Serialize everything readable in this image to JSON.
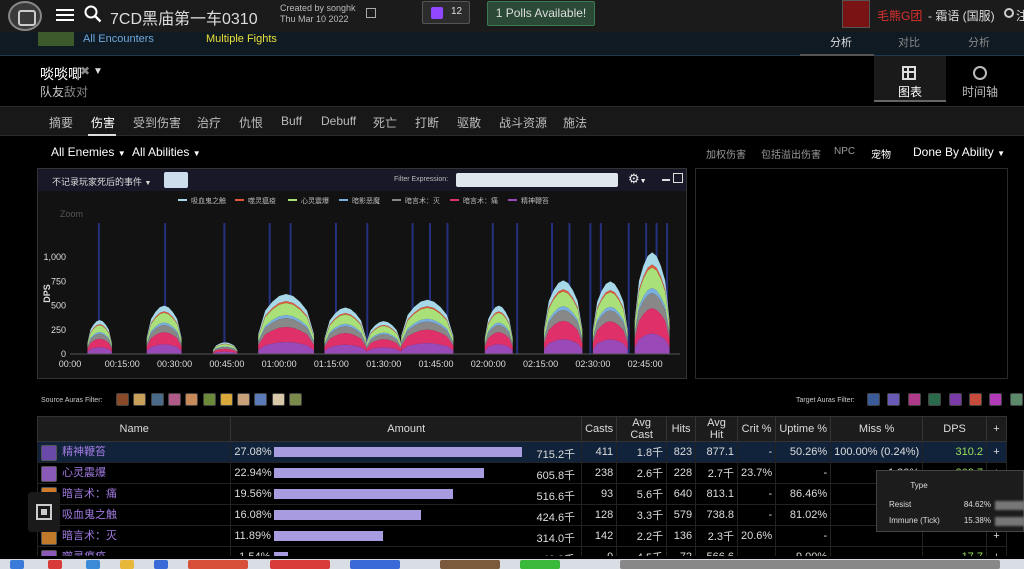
{
  "header": {
    "report_title": "7CD黑庙第一车0310",
    "created_by": "Created by songhk",
    "created_date": "Thu Mar 10 2022",
    "twitch_count": "12",
    "polls_label": "1 Polls Available!",
    "guild_name": "毛熊G团",
    "server_name": "- 霜语 (国服)",
    "user_name": "注"
  },
  "encounter_strip": {
    "all_encounters": "All Encounters",
    "multiple_fights": "Multiple Fights",
    "tabs": [
      "分析",
      "对比",
      "分析"
    ]
  },
  "player": {
    "name": "啖啖唧",
    "friend_label": "队友",
    "enemy_label": "敌对"
  },
  "view_buttons": {
    "chart": "图表",
    "timeline": "时间轴"
  },
  "tabs": [
    "摘要",
    "伤害",
    "受到伤害",
    "治疗",
    "仇恨",
    "Buff",
    "Debuff",
    "死亡",
    "打断",
    "驱散",
    "战斗资源",
    "施法"
  ],
  "filters": {
    "all_enemies": "All Enemies",
    "all_abilities": "All Abilities",
    "options": [
      "加权伤害",
      "包括溢出伤害",
      "NPC",
      "宠物"
    ],
    "done_by": "Done By Ability"
  },
  "chart_toolbar": {
    "dead_events": "不记录玩家死后的事件",
    "filter_expression_label": "Filter Expression:",
    "filter_expression_value": ""
  },
  "chart_data": {
    "type": "area",
    "ylabel": "DPS",
    "zoom_label": "Zoom",
    "ylim": [
      0,
      1250
    ],
    "yticks": [
      0,
      250,
      500,
      750,
      1000
    ],
    "ytick_labels": [
      "0",
      "250",
      "500",
      "750",
      "1,000"
    ],
    "xlim_minutes": [
      0,
      175
    ],
    "xticks": [
      "00:00",
      "00:15:00",
      "00:30:00",
      "00:45:00",
      "01:00:00",
      "01:15:00",
      "01:30:00",
      "01:45:00",
      "02:00:00",
      "02:15:00",
      "02:30:00",
      "02:45:00"
    ],
    "series": [
      {
        "name": "吸血鬼之触",
        "color": "#a6d8e8"
      },
      {
        "name": "噬灵瘟疫",
        "color": "#e05a3a"
      },
      {
        "name": "心灵震爆",
        "color": "#a9e07a"
      },
      {
        "name": "暗影恶魔",
        "color": "#7ab0e0"
      },
      {
        "name": "暗言术：灭",
        "color": "#888888"
      },
      {
        "name": "暗言术：痛",
        "color": "#e0306a"
      },
      {
        "name": "精神鞭笞",
        "color": "#9a4ab8"
      }
    ],
    "segments": [
      {
        "start": 5,
        "end": 12,
        "total": 350
      },
      {
        "start": 22,
        "end": 32,
        "total": 500
      },
      {
        "start": 41,
        "end": 48,
        "total": 120
      },
      {
        "start": 54,
        "end": 70,
        "total": 620
      },
      {
        "start": 73,
        "end": 85,
        "total": 480
      },
      {
        "start": 85,
        "end": 95,
        "total": 340
      },
      {
        "start": 95,
        "end": 110,
        "total": 560
      },
      {
        "start": 119,
        "end": 127,
        "total": 500
      },
      {
        "start": 136,
        "end": 147,
        "total": 760
      },
      {
        "start": 150,
        "end": 160,
        "total": 750
      },
      {
        "start": 162,
        "end": 172,
        "total": 1050
      }
    ]
  },
  "aura_filters": {
    "source_label": "Source Auras Filter:",
    "target_label": "Target Auras Filter:",
    "source_icons": [
      "aura-icon-1",
      "aura-icon-2",
      "aura-icon-3",
      "aura-icon-4",
      "aura-icon-5",
      "aura-icon-6",
      "aura-icon-7",
      "aura-icon-8",
      "aura-icon-9",
      "aura-icon-10",
      "aura-icon-11"
    ],
    "target_icons": [
      "aura-icon-1",
      "aura-icon-2",
      "aura-icon-3",
      "aura-icon-4",
      "aura-icon-5",
      "aura-icon-6",
      "aura-icon-7",
      "aura-icon-8"
    ]
  },
  "table": {
    "headers": [
      "Name",
      "Amount",
      "Casts",
      "Avg Cast",
      "Hits",
      "Avg Hit",
      "Crit %",
      "Uptime %",
      "Miss %",
      "DPS",
      "+"
    ],
    "rows": [
      {
        "name": "精神鞭笞",
        "pct": "27.08%",
        "fill": 0.992,
        "amount": "715.2千",
        "casts": "411",
        "avg_cast": "1.8千",
        "hits": "823",
        "avg_hit": "877.1",
        "crit": "-",
        "uptime": "50.26%",
        "miss": "100.00% (0.24%)",
        "dps": "310.2",
        "icon_color": "#6a4aa8"
      },
      {
        "name": "心灵震爆",
        "pct": "22.94%",
        "fill": 0.84,
        "amount": "605.8千",
        "casts": "238",
        "avg_cast": "2.6千",
        "hits": "228",
        "avg_hit": "2.7千",
        "crit": "23.7%",
        "uptime": "-",
        "miss": "1.30%",
        "dps": "262.7",
        "icon_color": "#8a5ab8"
      },
      {
        "name": "暗言术：痛",
        "pct": "19.56%",
        "fill": 0.716,
        "amount": "516.6千",
        "casts": "93",
        "avg_cast": "5.6千",
        "hits": "640",
        "avg_hit": "813.1",
        "crit": "-",
        "uptime": "86.46%",
        "miss": "",
        "dps": "",
        "icon_color": "#d07a2a"
      },
      {
        "name": "吸血鬼之触",
        "pct": "16.08%",
        "fill": 0.588,
        "amount": "424.6千",
        "casts": "128",
        "avg_cast": "3.3千",
        "hits": "579",
        "avg_hit": "738.8",
        "crit": "-",
        "uptime": "81.02%",
        "miss": "100.00%",
        "dps": "",
        "icon_color": "#5a3a9a"
      },
      {
        "name": "暗言术：灭",
        "pct": "11.89%",
        "fill": 0.436,
        "amount": "314.0千",
        "casts": "142",
        "avg_cast": "2.2千",
        "hits": "136",
        "avg_hit": "2.3千",
        "crit": "20.6%",
        "uptime": "-",
        "miss": "",
        "dps": "",
        "icon_color": "#c07a2a"
      },
      {
        "name": "噬灵瘟疫",
        "pct": "1.54%",
        "fill": 0.056,
        "amount": "40.8千",
        "casts": "9",
        "avg_cast": "4.5千",
        "hits": "72",
        "avg_hit": "566.6",
        "crit": "-",
        "uptime": "9.00%",
        "miss": "-",
        "dps": "17.7",
        "icon_color": "#8a5ab8"
      }
    ]
  },
  "tooltip": {
    "type_label": "Type",
    "rows": [
      {
        "label": "Resist",
        "value": "84.62%"
      },
      {
        "label": "Immune (Tick)",
        "value": "15.38%"
      }
    ]
  }
}
